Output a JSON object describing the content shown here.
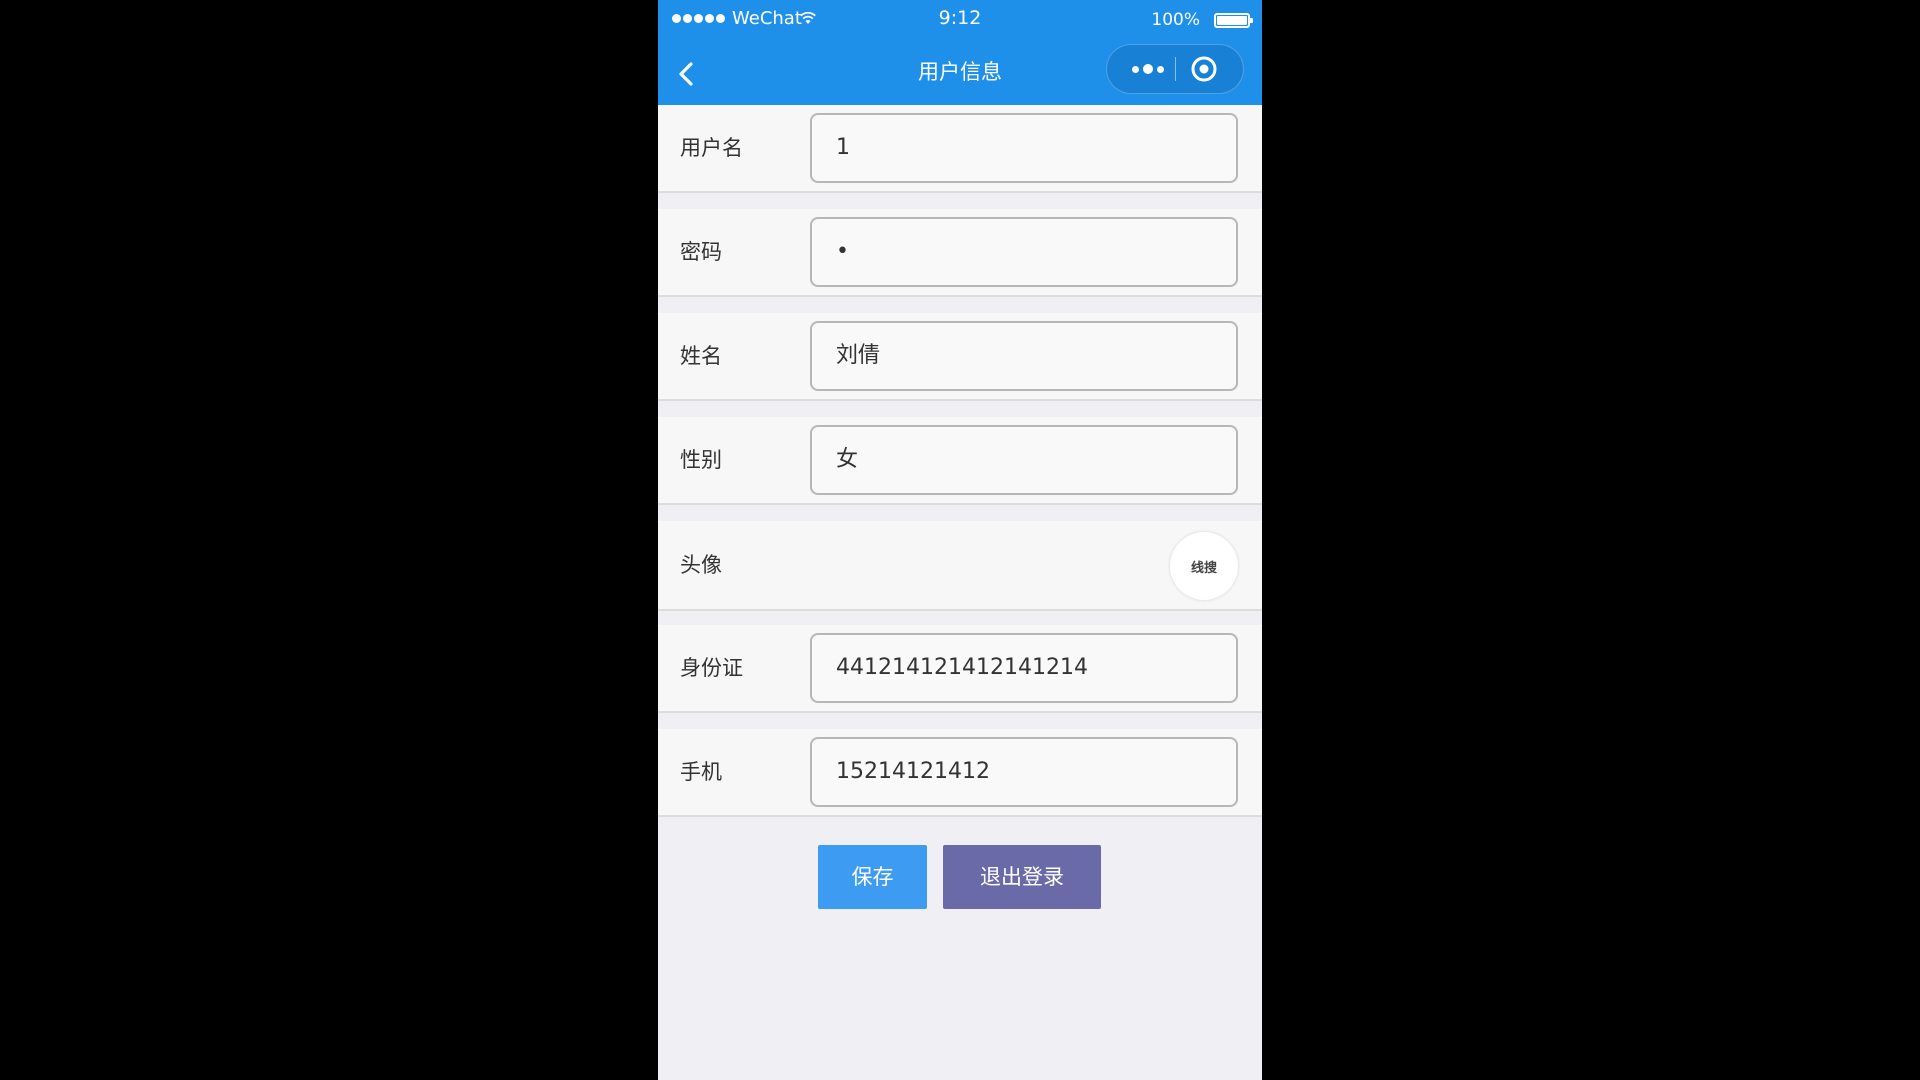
{
  "status_bar": {
    "carrier": "WeChat",
    "time": "9:12",
    "battery": "100%"
  },
  "nav": {
    "title": "用户信息"
  },
  "form": {
    "fields": [
      {
        "label": "用户名",
        "value": "1"
      },
      {
        "label": "密码",
        "value": "•"
      },
      {
        "label": "姓名",
        "value": "刘倩"
      },
      {
        "label": "性别",
        "value": "女"
      },
      {
        "label": "头像",
        "avatar_text": "线搜"
      },
      {
        "label": "身份证",
        "value": "441214121412141214"
      },
      {
        "label": "手机",
        "value": "15214121412"
      }
    ]
  },
  "buttons": {
    "save": "保存",
    "logout": "退出登录"
  },
  "colors": {
    "primary": "#1e90ea",
    "save_button": "#3d9cf2",
    "logout_button": "#6a6aa8",
    "background": "#efeff4",
    "outer_background": "#000000"
  }
}
